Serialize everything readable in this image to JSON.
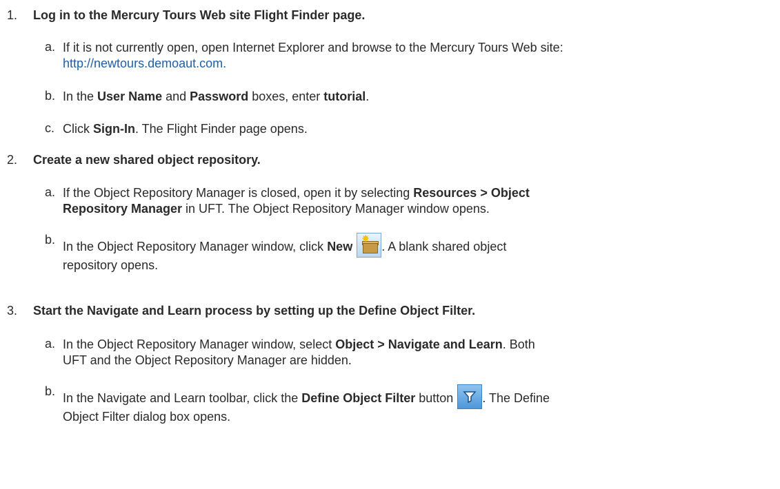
{
  "steps": [
    {
      "number": "1.",
      "title": "Log in to the Mercury Tours Web site Flight Finder page.",
      "substeps": [
        {
          "letter": "a.",
          "line1": "If it is not currently open, open Internet Explorer and browse to the Mercury Tours Web site:",
          "link": "http://newtours.demoaut.com."
        },
        {
          "letter": "b.",
          "t1": "In the ",
          "b1": "User Name",
          "t2": " and ",
          "b2": "Password",
          "t3": " boxes, enter ",
          "b3": "tutorial",
          "t4": "."
        },
        {
          "letter": "c.",
          "t1": "Click ",
          "b1": "Sign-In",
          "t2": ". The Flight Finder page opens."
        }
      ]
    },
    {
      "number": "2.",
      "title": "Create a new shared object repository.",
      "substeps": [
        {
          "letter": "a.",
          "t1": "If the Object Repository Manager is closed, open it by selecting ",
          "b1": "Resources > Object",
          "b2": "Repository Manager",
          "t2": " in UFT. The Object Repository Manager window opens."
        },
        {
          "letter": "b.",
          "t1": "In the Object Repository Manager window, click ",
          "b1": "New",
          "t2": ". A blank shared object",
          "t3": "repository opens.",
          "icon": "new-repository-icon"
        }
      ]
    },
    {
      "number": "3.",
      "title": "Start the Navigate and Learn process by setting up the Define Object Filter.",
      "substeps": [
        {
          "letter": "a.",
          "t1": "In the Object Repository Manager window, select ",
          "b1": "Object > Navigate and Learn",
          "t2": ". Both",
          "t3": "UFT and the Object Repository Manager are hidden."
        },
        {
          "letter": "b.",
          "t1": "In the Navigate and Learn toolbar, click the ",
          "b1": "Define Object Filter",
          "t2": " button",
          "t3": ". The Define",
          "t4": "Object Filter dialog box opens.",
          "icon": "filter-icon"
        }
      ]
    }
  ],
  "colors": {
    "text": "#2a2a2a",
    "link": "#1f5fa6"
  }
}
